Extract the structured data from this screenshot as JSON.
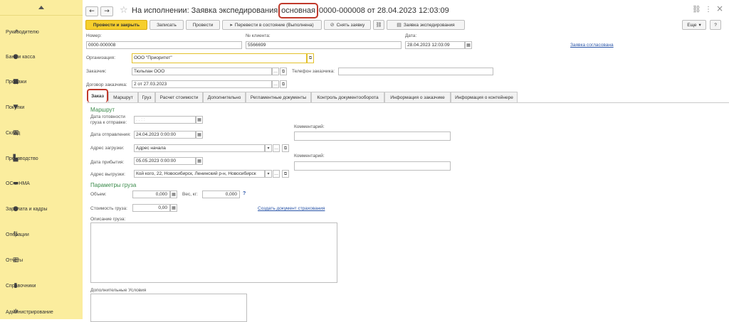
{
  "sidebar": {
    "items": [
      {
        "label": "Руководителю",
        "icon": "chart-icon",
        "glyph": "↗"
      },
      {
        "label": "Банк и касса",
        "icon": "coin-icon",
        "glyph": "●"
      },
      {
        "label": "Продажи",
        "icon": "shopping-bag-icon",
        "glyph": "■"
      },
      {
        "label": "Покупки",
        "icon": "cart-icon",
        "glyph": "▼"
      },
      {
        "label": "Склад",
        "icon": "warehouse-icon",
        "glyph": "▦"
      },
      {
        "label": "Производство",
        "icon": "factory-icon",
        "glyph": "▙"
      },
      {
        "label": "ОС и НМА",
        "icon": "truck-icon",
        "glyph": "▬"
      },
      {
        "label": "Зарплата и кадры",
        "icon": "person-icon",
        "glyph": "●"
      },
      {
        "label": "Операции",
        "icon": "operations-icon",
        "glyph": "⇅"
      },
      {
        "label": "Отчеты",
        "icon": "report-icon",
        "glyph": "▥"
      },
      {
        "label": "Справочники",
        "icon": "book-icon",
        "glyph": "▮"
      },
      {
        "label": "Администрирование",
        "icon": "gear-icon",
        "glyph": "✲"
      }
    ]
  },
  "header": {
    "back": "←",
    "forward": "→",
    "star": "☆",
    "title_prefix": "На исполнении: Заявка экспедирования",
    "title_highlight": "основная",
    "title_suffix": "0000-000008 от 28.04.2023 12:03:09",
    "link_glyph": "⛓",
    "more_glyph": "⋮",
    "close_glyph": "×"
  },
  "toolbar": {
    "post_close": "Провести и закрыть",
    "save": "Записать",
    "post": "Провести",
    "transfer": "Перевести в состояние (Выполнена)",
    "cancel_request": "Снять заявку",
    "request_print": "Заявка экспедирования",
    "more": "Еще",
    "help": "?"
  },
  "form": {
    "number_label": "Номер:",
    "number_value": "0000-000008",
    "client_no_label": "№ клиента:",
    "client_no_value": "5566699",
    "date_label": "Дата:",
    "date_value": "28.04.2023 12:03:09",
    "approved_link": "Заявка согласована",
    "org_label": "Организация:",
    "org_value": "ООО \"Приоритет\"",
    "customer_label": "Заказчик:",
    "customer_value": "Тюльпан ООО",
    "phone_label": "Телефон заказчика:",
    "phone_value": "",
    "contract_label": "Договор заказчика:",
    "contract_value": "2 от 27.03.2023"
  },
  "tabs": [
    "Заказ",
    "Маршрут",
    "Груз",
    "Расчет стоимости",
    "Дополнительно",
    "Регламентные документы",
    "Контроль документооборота",
    "Информация о заказчике",
    "Информация о контейнере"
  ],
  "route": {
    "title": "Маршрут",
    "ready_label_1": "Дата готовности",
    "ready_label_2": "груза к отправке:",
    "ready_value": ". .   : :",
    "dispatch_label": "Дата отправления:",
    "dispatch_value": "24.04.2023  0:00:00",
    "load_label": "Адрес загрузки:",
    "load_value": "Адрес начала",
    "arrival_label": "Дата прибытия:",
    "arrival_value": "05.05.2023  0:00:00",
    "unload_label": "Адрес выгрузки:",
    "unload_value": "Кой кого, 22, Новосибирск, Ленинский р-н, Новосибирск",
    "comment1_label": "Комментарий:",
    "comment2_label": "Комментарий:"
  },
  "cargo": {
    "title": "Параметры груза",
    "volume_label": "Объем:",
    "volume_value": "0,000",
    "weight_label": "Вес, кг:",
    "weight_value": "0,000",
    "help": "?",
    "cost_label": "Стоимость груза:",
    "cost_value": "0,00",
    "insurance_link": "Создать документ страхования",
    "description_label": "Описание груза:",
    "extra_label": "Дополнительные Условия"
  }
}
